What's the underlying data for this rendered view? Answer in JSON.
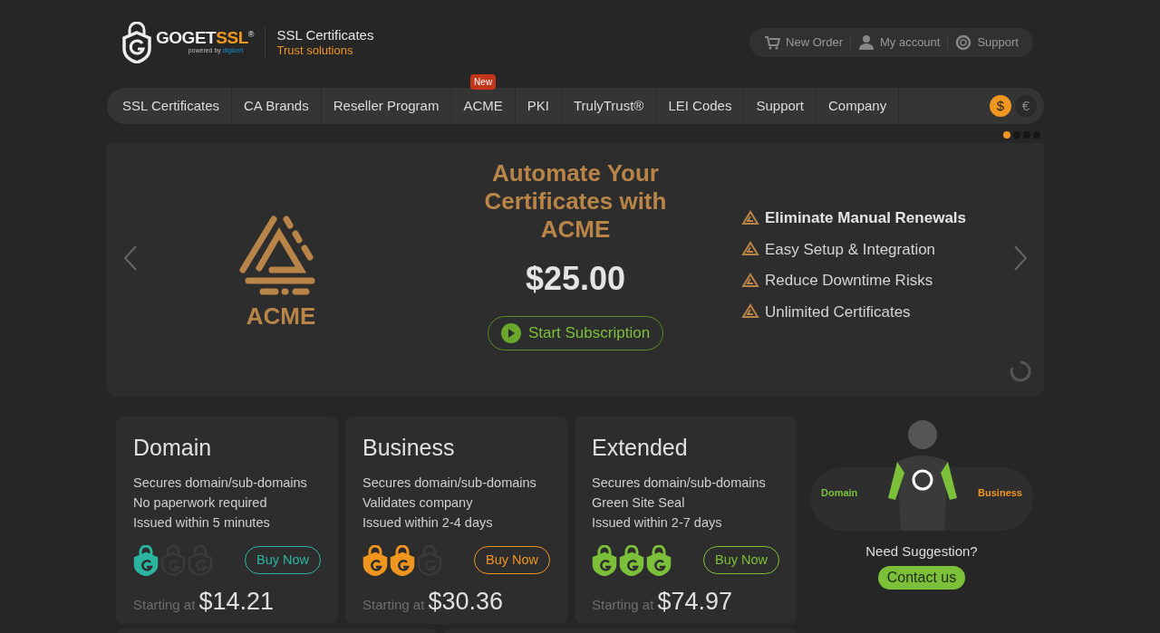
{
  "logo": {
    "brand_main": "GOGET",
    "brand_accent": "SSL",
    "registered": "®",
    "powered": "powered by",
    "powered_brand": "digicert"
  },
  "tagline": {
    "title": "SSL Certificates",
    "subtitle": "Trust solutions"
  },
  "top_links": [
    {
      "kind": "cart",
      "label": "New Order"
    },
    {
      "kind": "user",
      "label": "My account"
    },
    {
      "kind": "lifebuoy",
      "label": "Support"
    }
  ],
  "nav": [
    {
      "label": "SSL Certificates"
    },
    {
      "label": "CA Brands"
    },
    {
      "label": "Reseller Program"
    },
    {
      "label": "ACME",
      "badge": "New"
    },
    {
      "label": "PKI"
    },
    {
      "label": "TrulyTrust®"
    },
    {
      "label": "LEI Codes"
    },
    {
      "label": "Support"
    },
    {
      "label": "Company"
    }
  ],
  "currencies": [
    {
      "symbol": "$",
      "selected": true
    },
    {
      "symbol": "€",
      "selected": false
    }
  ],
  "slides": [
    {
      "selected": true
    },
    {
      "selected": false
    },
    {
      "selected": false
    },
    {
      "selected": false
    }
  ],
  "hero": {
    "logo_label": "ACME",
    "title": "Automate Your Certificates with ACME",
    "price": "$25.00",
    "button": "Start Subscription",
    "features": [
      {
        "text": "Eliminate Manual Renewals",
        "bold": true
      },
      {
        "text": "Easy Setup & Integration",
        "bold": false
      },
      {
        "text": "Reduce Downtime Risks",
        "bold": false
      },
      {
        "text": "Unlimited Certificates",
        "bold": false
      }
    ]
  },
  "plans": [
    {
      "name": "Domain",
      "color": "#2bb5a0",
      "shields": [
        {
          "filled": true
        },
        {
          "filled": false
        },
        {
          "filled": false
        }
      ],
      "features": [
        "Secures domain/sub-domains",
        "No paperwork required",
        "Issued within 5 minutes"
      ],
      "button": "Buy Now",
      "starting": "Starting at",
      "price": "$14.21"
    },
    {
      "name": "Business",
      "color": "#f0961e",
      "shields": [
        {
          "filled": true
        },
        {
          "filled": true
        },
        {
          "filled": false
        }
      ],
      "features": [
        "Secures domain/sub-domains",
        "Validates company",
        "Issued within 2-4 days"
      ],
      "button": "Buy Now",
      "starting": "Starting at",
      "price": "$30.36"
    },
    {
      "name": "Extended",
      "color": "#7cc03a",
      "shields": [
        {
          "filled": true
        },
        {
          "filled": true
        },
        {
          "filled": true
        }
      ],
      "features": [
        "Secures domain/sub-domains",
        "Green Site Seal",
        "Issued within 2-7 days"
      ],
      "button": "Buy Now",
      "starting": "Starting at",
      "price": "$74.97"
    }
  ],
  "suggestion": {
    "left_label": "Domain",
    "right_label": "Business",
    "question": "Need Suggestion?",
    "button": "Contact us"
  }
}
